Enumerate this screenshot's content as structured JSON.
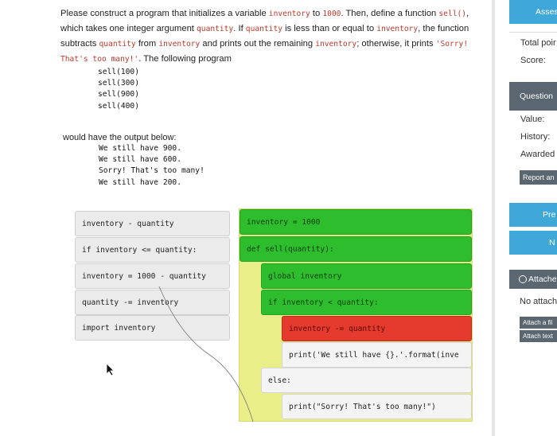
{
  "prompt": {
    "t1": "Please construct a program that initializes a variable ",
    "c1": "inventory",
    "t2": " to ",
    "c2": "1000",
    "t3": ". Then, define a function ",
    "c3": "sell()",
    "t4": ", which takes one integer argument ",
    "c4": "quantity",
    "t5": ". If ",
    "c5": "quantity",
    "t6": " is less than or equal to ",
    "c6": "inventory",
    "t7": ", the function subtracts ",
    "c7": "quantity",
    "t8": " from ",
    "c8": "inventory",
    "t9": " and prints out the remaining ",
    "c9": "inventory",
    "t10": "; otherwise, it prints ",
    "c10": "'Sorry! That's too many!'",
    "t11": ". The following program"
  },
  "example_code": [
    "sell(100)",
    "sell(300)",
    "sell(900)",
    "sell(400)"
  ],
  "output_label": "would have the output below:",
  "example_output": [
    "We still have 900.",
    "We still have 600.",
    "Sorry! That's too many!",
    "We still have 200."
  ],
  "source_blocks": [
    "inventory - quantity",
    "if inventory <= quantity:",
    "inventory = 1000 - quantity",
    "quantity -= inventory",
    "import inventory"
  ],
  "solution_blocks": [
    {
      "text": "inventory = 1000",
      "state": "green"
    },
    {
      "text": "def sell(quantity):",
      "state": "green"
    },
    {
      "text": "global inventory",
      "state": "green"
    },
    {
      "text": "if inventory < quantity:",
      "state": "green"
    },
    {
      "text": "inventory -= quantity",
      "state": "red"
    },
    {
      "text": "print('We still have {}.'.format(inve",
      "state": "neutral"
    },
    {
      "text": "else:",
      "state": "neutral"
    },
    {
      "text": "print(\"Sorry! That's too many!\")",
      "state": "neutral"
    }
  ],
  "right_panel": {
    "assess_button": "Asses",
    "total_points_label": "Total poir",
    "score_label": "Score:",
    "question_button": "Question",
    "value_label": "Value:",
    "history_label": "History:",
    "awarded_label": "Awarded",
    "report_button": "Report an",
    "prev_button": "Pre",
    "next_button": "N",
    "attached_header": "Attache",
    "no_attach_label": "No attach",
    "attach_file_button": "Attach a fil",
    "attach_text_button": "Attach text"
  },
  "colors": {
    "assess_blue": "#3fa8d8",
    "question_gray": "#5a6670",
    "green_block": "#2dbd2d",
    "red_block": "#e53a2e",
    "solution_area": "#e9ee89"
  }
}
